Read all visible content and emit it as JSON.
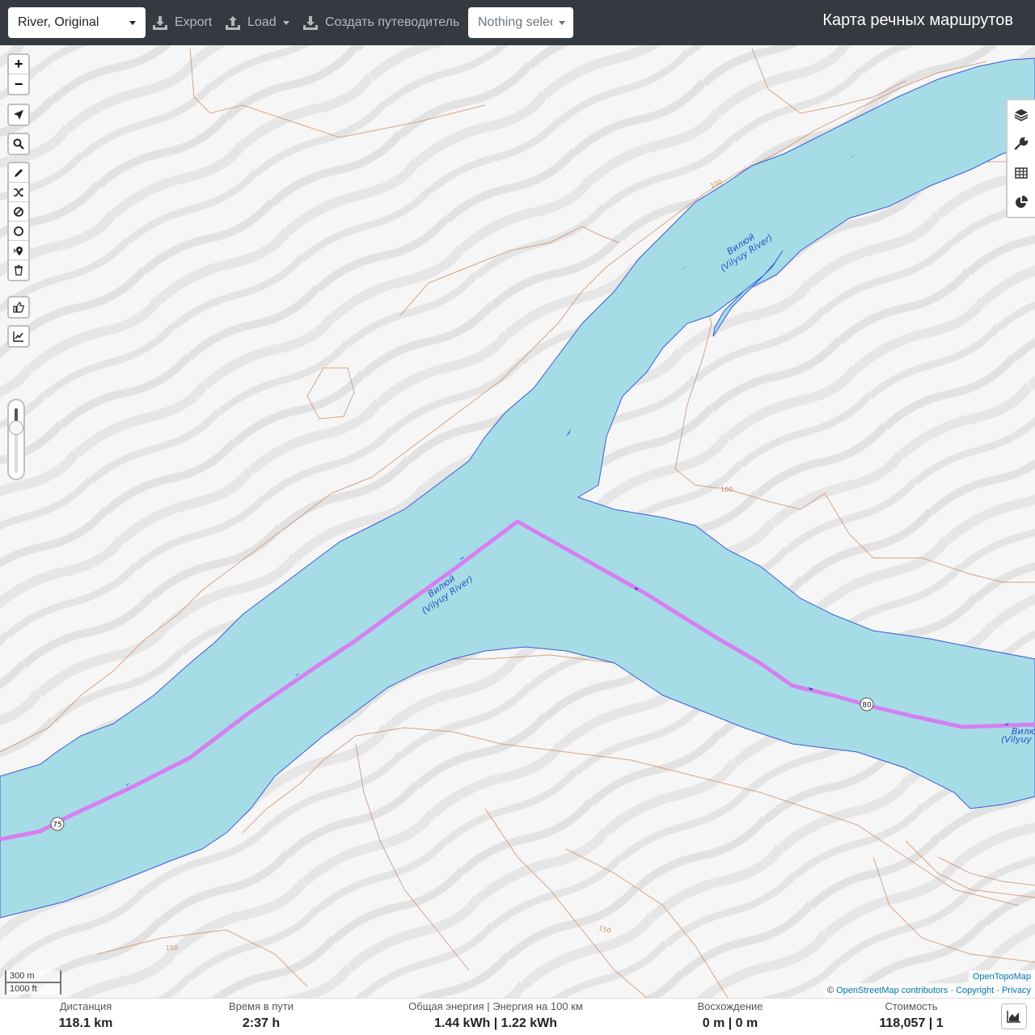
{
  "header": {
    "profile": "River, Original",
    "export_label": "Export",
    "load_label": "Load",
    "guide_label": "Создать путеводитель",
    "selection_placeholder": "Nothing selected",
    "app_title": "Карта речных маршрутов"
  },
  "map": {
    "river_labels": [
      "Вилюй",
      "(Vilyuy River)"
    ],
    "route_markers": [
      "75",
      "80"
    ],
    "contour_labels": [
      "100",
      "150"
    ],
    "scale_metric": "300 m",
    "scale_imperial": "1000 ft",
    "attribution_layer": "OpenTopoMap",
    "attribution_prefix": "©",
    "attribution_osm": "OpenStreetMap contributors",
    "attribution_copyright": "Copyright",
    "attribution_privacy": "Privacy",
    "colors": {
      "water": "#a6dce6",
      "route": "#d580f0",
      "contour": "#c98a63",
      "water_outline": "#3a5bd9"
    },
    "transparency_slider_level": 0.8
  },
  "controls_left": [
    "zoom-in-icon",
    "zoom-out-icon",
    "locate-icon",
    "search-icon",
    "draw-route-icon",
    "shuffle-icon",
    "no-go-area-icon",
    "circle-icon",
    "poi-icon",
    "trash-icon",
    "thumbs-up-icon",
    "elevation-chart-icon"
  ],
  "controls_right": [
    "layers-icon",
    "wrench-icon",
    "table-icon",
    "pie-chart-icon"
  ],
  "stats": {
    "distance_label": "Дистанция",
    "distance_value": "118.1 km",
    "time_label": "Время в пути",
    "time_value": "2:37 h",
    "energy_label": "Общая энергия | Энергия на 100 км",
    "energy_value": "1.44 kWh | 1.22 kWh",
    "ascent_label": "Восхождение",
    "ascent_value": "0 m | 0 m",
    "cost_label": "Стоимость",
    "cost_value": "118,057 | 1"
  }
}
